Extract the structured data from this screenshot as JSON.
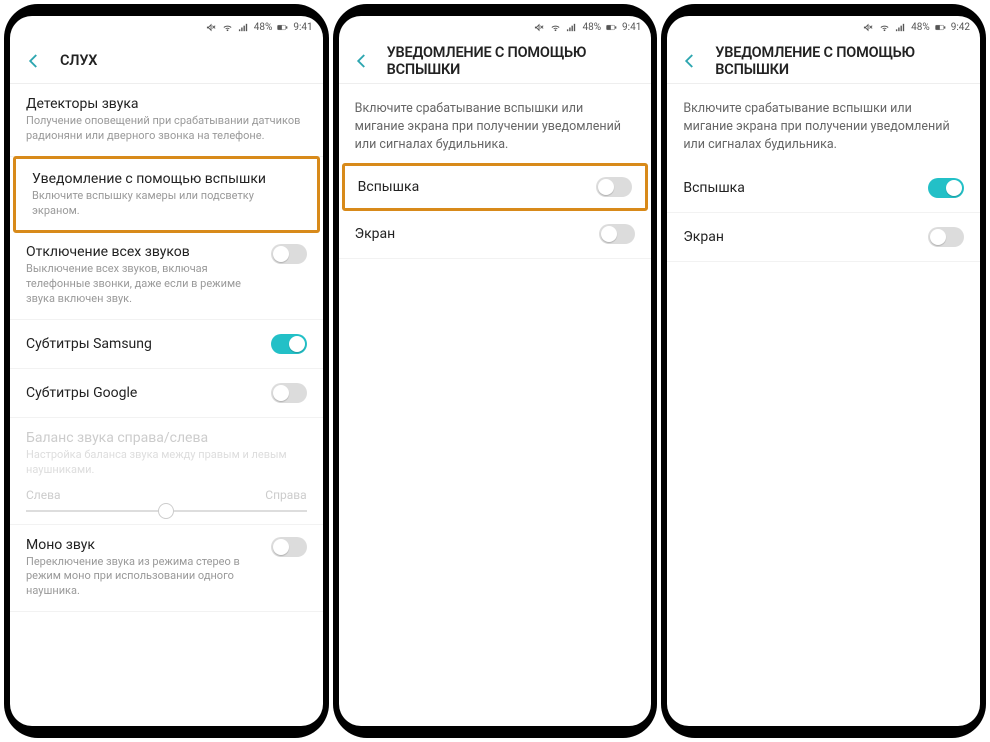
{
  "statusbar": {
    "battery_text": "48%",
    "time_a": "9:41",
    "time_c": "9:42"
  },
  "screen1": {
    "title": "СЛУХ",
    "items": [
      {
        "title": "Детекторы звука",
        "sub": "Получение оповещений при срабатывании датчиков радионяни или дверного звонка на телефоне."
      },
      {
        "title": "Уведомление с помощью вспышки",
        "sub": "Включите вспышку камеры или подсветку экраном."
      },
      {
        "title": "Отключение всех звуков",
        "sub": "Выключение всех звуков, включая телефонные звонки, даже если в режиме звука включен звук."
      },
      {
        "title": "Субтитры Samsung"
      },
      {
        "title": "Субтитры Google"
      },
      {
        "title": "Баланс звука справа/слева",
        "sub": "Настройка баланса звука между правым и левым наушниками.",
        "left": "Слева",
        "right": "Справа"
      },
      {
        "title": "Моно звук",
        "sub": "Переключение звука из режима стерео в режим моно при использовании одного наушника."
      }
    ]
  },
  "screen2": {
    "title": "УВЕДОМЛЕНИЕ С ПОМОЩЬЮ ВСПЫШКИ",
    "desc": "Включите срабатывание вспышки или мигание экрана при получении уведомлений или сигналах будильника.",
    "rows": [
      {
        "label": "Вспышка",
        "on": false
      },
      {
        "label": "Экран",
        "on": false
      }
    ]
  },
  "screen3": {
    "title": "УВЕДОМЛЕНИЕ С ПОМОЩЬЮ ВСПЫШКИ",
    "desc": "Включите срабатывание вспышки или мигание экрана при получении уведомлений или сигналах будильника.",
    "rows": [
      {
        "label": "Вспышка",
        "on": true
      },
      {
        "label": "Экран",
        "on": false
      }
    ]
  }
}
